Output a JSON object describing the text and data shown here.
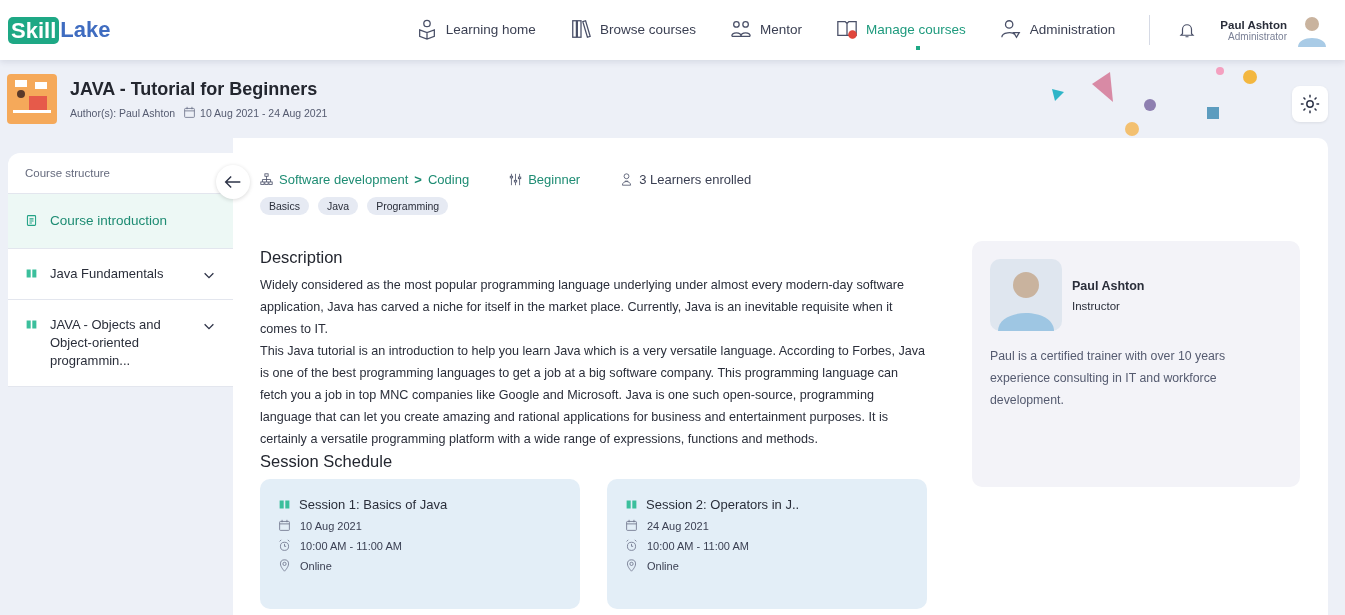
{
  "logo": {
    "part_1": "Skill",
    "part_2": "Lake"
  },
  "nav": [
    {
      "label": "Learning home",
      "selected": false
    },
    {
      "label": "Browse courses",
      "selected": false
    },
    {
      "label": "Mentor",
      "selected": false
    },
    {
      "label": "Manage courses",
      "selected": true
    },
    {
      "label": "Administration",
      "selected": false
    }
  ],
  "user": {
    "name": "Paul Ashton",
    "role": "Administrator"
  },
  "course": {
    "title": "JAVA - Tutorial for Beginners",
    "authors": "Author(s): Paul Ashton",
    "dates": "10 Aug 2021 - 24 Aug 2021"
  },
  "sidebar": {
    "heading": "Course structure",
    "items": [
      {
        "label": "Course introduction",
        "kind": "page",
        "selected": true
      },
      {
        "label": "Java Fundamentals",
        "kind": "module",
        "selected": false,
        "expanded": false
      },
      {
        "label": "JAVA - Objects and Object-oriented programmin...",
        "kind": "module",
        "selected": false,
        "expanded": false
      }
    ]
  },
  "meta": {
    "category": "Software development",
    "subcategory": "Coding",
    "separator": ">",
    "level": "Beginner",
    "learners": "3 Learners enrolled"
  },
  "tags": [
    "Basics",
    "Java",
    "Programming"
  ],
  "description": {
    "heading": "Description",
    "paragraphs": [
      "Widely considered as the most popular programming language underlying under almost every modern-day software application, Java has carved a niche for itself in the market place. Currently, Java is an inevitable requisite when it comes to IT.",
      "This Java tutorial is an introduction to help you learn Java which is a very versatile language. According to Forbes, Java is one of the best programming languages to get a job at a big software company. This programming language can fetch you a job in top MNC companies like Google and Microsoft. Java is one such open-source, programming language that can let you create amazing and rational applications for business and entertainment purposes. It is certainly a versatile programming platform with a wide range of expressions, functions and methods."
    ]
  },
  "schedule": {
    "heading": "Session Schedule",
    "sessions": [
      {
        "title": "Session 1: Basics of Java",
        "date": "10 Aug 2021",
        "time": "10:00 AM - 11:00 AM",
        "location": "Online"
      },
      {
        "title": "Session 2: Operators in J..",
        "date": "24 Aug 2021",
        "time": "10:00 AM - 11:00 AM",
        "location": "Online"
      }
    ]
  },
  "instructor": {
    "name": "Paul Ashton",
    "role": "Instructor",
    "bio": "Paul is a certified trainer with over 10 years experience consulting in IT and workforce development."
  }
}
